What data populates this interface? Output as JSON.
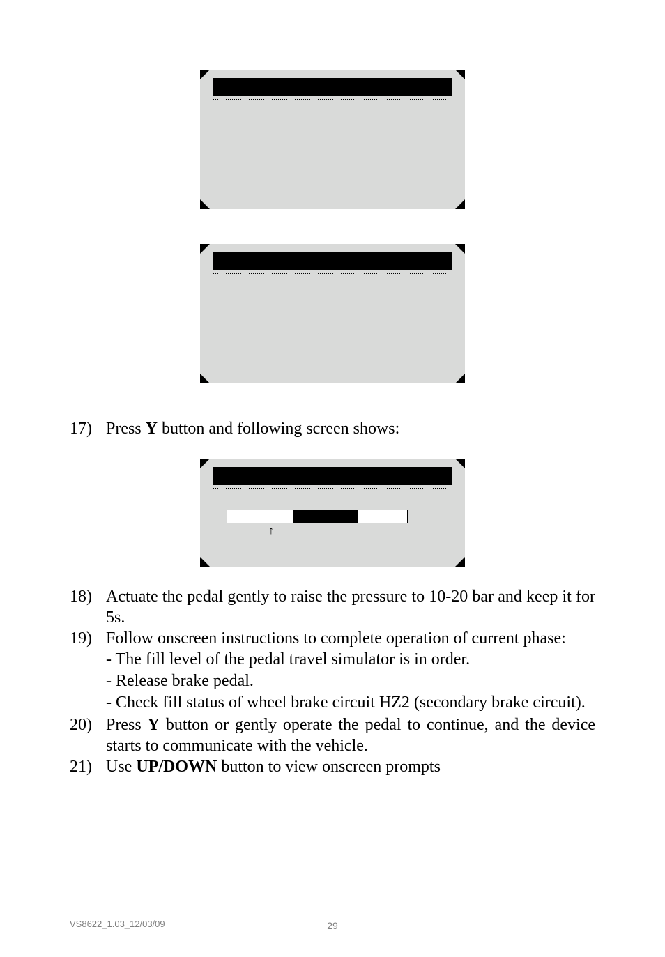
{
  "step17_intro": "Press ",
  "step17_bold": "Y",
  "step17_rest": " button and following screen shows:",
  "step17_num": "17)",
  "step18": {
    "num": "18)",
    "text": "Actuate the pedal gently to raise the pressure to 10-20 bar and keep it for 5s."
  },
  "step19": {
    "num": "19)",
    "text": "Follow onscreen instructions to complete operation of current phase:",
    "sub1": "- The fill level of the pedal travel simulator is in order.",
    "sub2": "- Release brake pedal.",
    "sub3": "- Check fill status of wheel brake circuit HZ2 (secondary brake circuit)."
  },
  "step20": {
    "num": "20)",
    "text_before": "Press ",
    "bold": "Y",
    "text_after": " button or gently operate the pedal to continue, and the device starts to communicate with the vehicle."
  },
  "step21": {
    "num": "21)",
    "text_before": "Use ",
    "bold": "UP/DOWN",
    "text_after": " button to view onscreen prompts"
  },
  "footer_left": "VS8622_1.03_12/03/09",
  "page_number": "29",
  "arrow": "↑"
}
